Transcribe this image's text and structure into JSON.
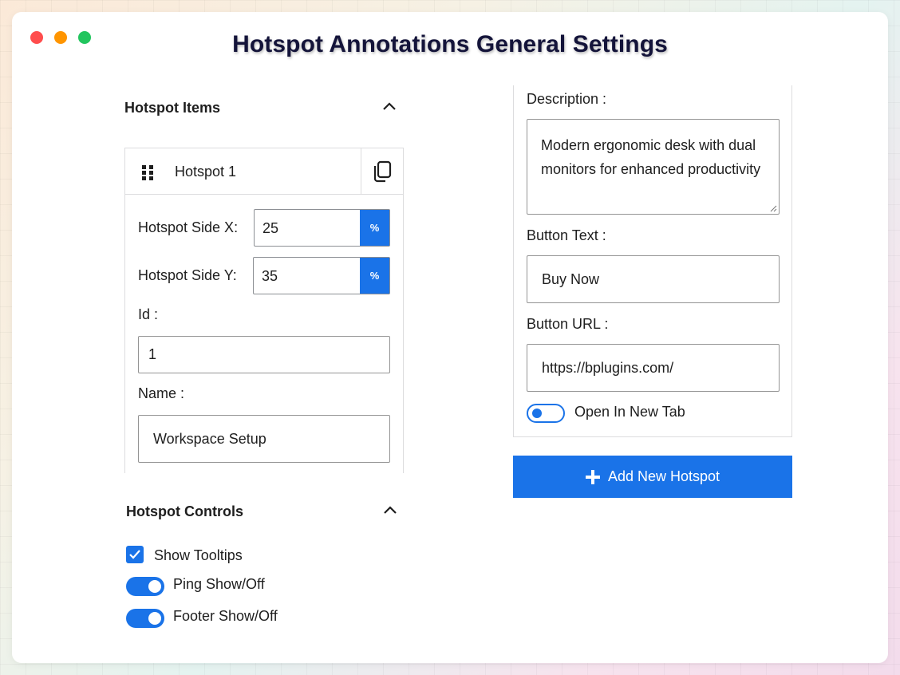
{
  "window": {
    "title": "Hotspot Annotations General Settings"
  },
  "hotspot_items": {
    "heading": "Hotspot Items",
    "item": {
      "label": "Hotspot 1",
      "side_x_label": "Hotspot Side X:",
      "side_x_value": "25",
      "side_y_label": "Hotspot Side Y:",
      "side_y_value": "35",
      "unit": "%",
      "id_label": "Id :",
      "id_value": "1",
      "name_label": "Name :",
      "name_value": "Workspace Setup",
      "description_label": "Description :",
      "description_value": "Modern ergonomic desk with dual monitors for enhanced productivity",
      "button_text_label": "Button Text :",
      "button_text_value": "Buy Now",
      "button_url_label": "Button URL :",
      "button_url_value": "https://bplugins.com/",
      "new_tab_label": "Open In New Tab",
      "new_tab_enabled": false
    },
    "add_button_label": "Add New Hotspot"
  },
  "hotspot_controls": {
    "heading": "Hotspot Controls",
    "show_tooltips_label": "Show Tooltips",
    "show_tooltips_checked": true,
    "ping_label": "Ping Show/Off",
    "ping_enabled": true,
    "footer_label": "Footer Show/Off",
    "footer_enabled": true
  },
  "colors": {
    "accent": "#1a73e8",
    "title": "#14143a",
    "close_dot": "#ff4d4d",
    "minimize_dot": "#ff9500",
    "maximize_dot": "#22c55e"
  }
}
